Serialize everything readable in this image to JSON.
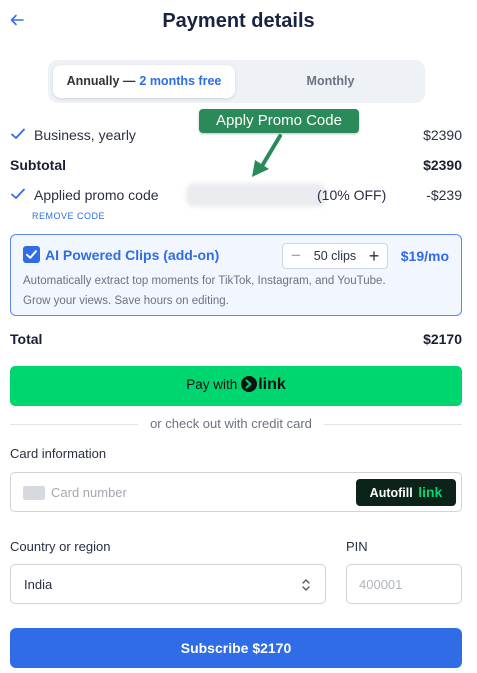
{
  "header": {
    "back_icon": "arrow-left-icon",
    "title": "Payment details"
  },
  "billing_toggle": {
    "annual_label": "Annually —",
    "annual_badge": "2 months free",
    "monthly_label": "Monthly",
    "selected": "Annually"
  },
  "promo_callout": {
    "text": "Apply Promo Code"
  },
  "summary": {
    "plan_label": "Business, yearly",
    "plan_amount": "$2390",
    "subtotal_label": "Subtotal",
    "subtotal_amount": "$2390",
    "promo_label": "Applied promo code",
    "promo_discount_text": "(10% OFF)",
    "promo_amount": "-$239",
    "remove_code": "REMOVE CODE"
  },
  "addon": {
    "checked": true,
    "title": "AI Powered Clips (add-on)",
    "quantity": "50 clips",
    "price": "$19/mo",
    "description_line1": "Automatically extract top moments for TikTok, Instagram, and YouTube.",
    "description_line2": "Grow your views. Save hours on editing."
  },
  "total": {
    "label": "Total",
    "amount": "$2170"
  },
  "link_pay": {
    "prefix": "Pay with",
    "brand": "link"
  },
  "divider_text": "or check out with credit card",
  "card": {
    "label": "Card information",
    "placeholder": "Card number",
    "autofill_label": "Autofill",
    "autofill_brand": "link"
  },
  "country": {
    "label": "Country or region",
    "value": "India"
  },
  "pin": {
    "label": "PIN",
    "placeholder": "400001"
  },
  "subscribe": {
    "label": "Subscribe $2170"
  },
  "colors": {
    "accent_blue": "#2f6ce5",
    "link_green": "#00d66f",
    "callout_green": "#2a8a5a"
  }
}
